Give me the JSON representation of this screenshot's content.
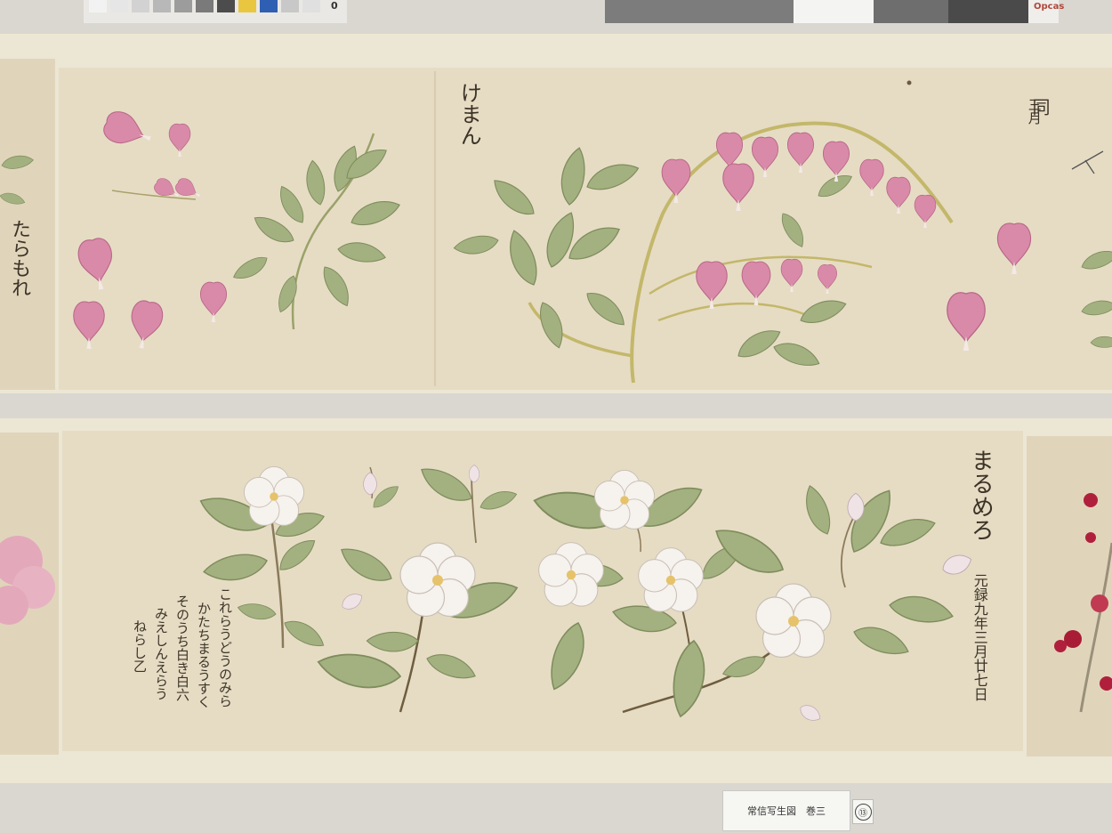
{
  "calibration": {
    "left_text": "0",
    "right_text": "Opcas"
  },
  "panel_top": {
    "name_left": "たらもれ",
    "name_main": "けまん",
    "annotation_right_1": "同",
    "annotation_right_2": "三月"
  },
  "panel_bottom": {
    "name_main": "まるめろ",
    "date": "元録九年三月廿七日",
    "note_lines": [
      "これらうどうのみら",
      "かたちまるうすく",
      "そのうち白き白六",
      "みえしんえらう",
      "ねらし乙"
    ]
  },
  "caption": {
    "title": "常信写生図　巻三",
    "number": "⑬"
  },
  "colors": {
    "paper": "#e6dcc4",
    "mount": "#ece6d4",
    "pink_flower": "#d98aa8",
    "white_flower": "#f5f1ec",
    "leaf": "#9aa878",
    "stem": "#bcb06a"
  }
}
